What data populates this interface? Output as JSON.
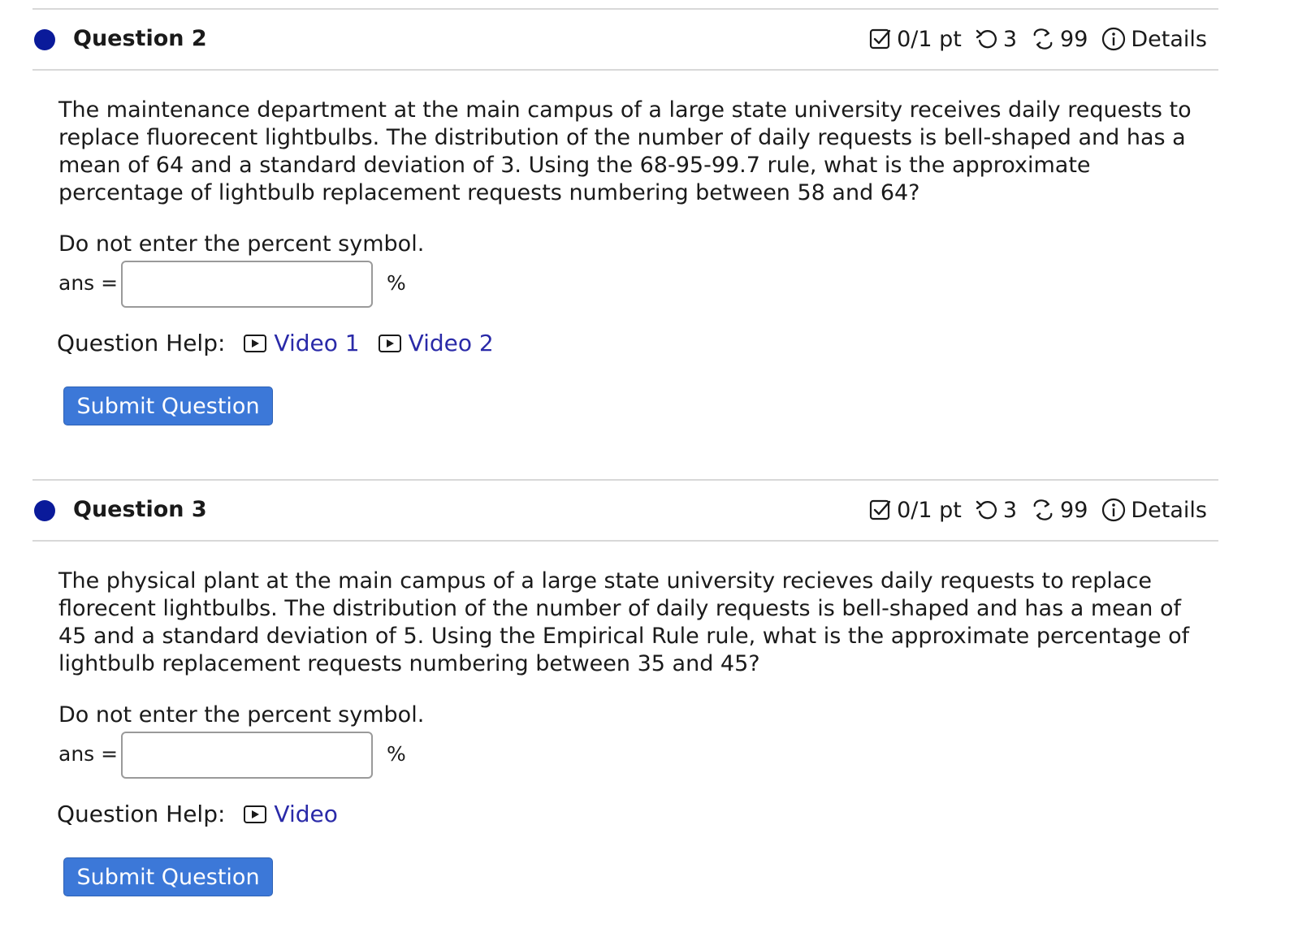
{
  "questions": [
    {
      "title": "Question 2",
      "score": "0/1 pt",
      "retries": "3",
      "attempts": "99",
      "details_label": "Details",
      "body": "The maintenance department at the main campus of a large state university receives daily requests to replace fluorecent lightbulbs. The distribution of the number of daily requests is bell-shaped and has a mean of 64 and a standard deviation of 3. Using the 68-95-99.7 rule, what is the approximate percentage of lightbulb replacement requests numbering between 58 and 64?",
      "note": "Do not enter the percent symbol.",
      "ans_label": "ans =",
      "ans_value": "",
      "percent": "%",
      "help_label": "Question Help:",
      "videos": [
        "Video 1",
        "Video 2"
      ],
      "submit_label": "Submit Question"
    },
    {
      "title": "Question 3",
      "score": "0/1 pt",
      "retries": "3",
      "attempts": "99",
      "details_label": "Details",
      "body": "The physical plant at the main campus of a large state university recieves daily requests to replace florecent lightbulbs. The distribution of the number of daily requests is bell-shaped and has a mean of 45 and a standard deviation of 5. Using the Empirical Rule rule, what is the approximate percentage of lightbulb replacement requests numbering between 35 and 45?",
      "note": "Do not enter the percent symbol.",
      "ans_label": "ans =",
      "ans_value": "",
      "percent": "%",
      "help_label": "Question Help:",
      "videos": [
        "Video"
      ],
      "submit_label": "Submit Question"
    }
  ],
  "colors": {
    "status_dot": "#0a1a9a",
    "link": "#2a2aa8",
    "button": "#3c78d8"
  },
  "icons": {
    "score": "checkbox-icon",
    "retry": "retry-icon",
    "attempts": "attempts-icon",
    "details": "info-icon",
    "video": "video-play-icon"
  }
}
